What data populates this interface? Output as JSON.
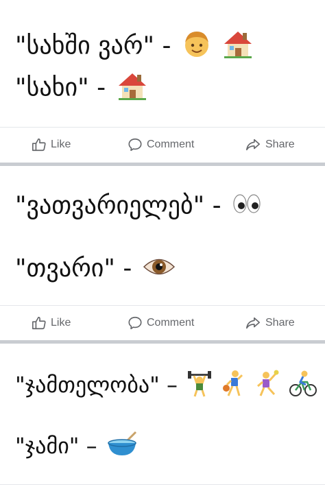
{
  "posts": [
    {
      "lines": [
        {
          "text": "\"სახში ვარ\" -",
          "emojis": [
            "person-face-icon",
            "house-icon"
          ]
        },
        {
          "text": "\"სახი\" -",
          "emojis": [
            "house-icon"
          ]
        }
      ]
    },
    {
      "lines": [
        {
          "text": "\"ვათვარიელებ\" -",
          "emojis": [
            "eyes-icon"
          ]
        },
        {
          "text": "\"თვარი\" -",
          "emojis": [
            "eye-icon"
          ]
        }
      ]
    },
    {
      "lines": [
        {
          "text": "\"ჯამთელობა\" –",
          "emojis": [
            "weightlifter-icon",
            "basketball-player-icon",
            "handball-player-icon",
            "cyclist-icon"
          ]
        },
        {
          "text": "\"ჯამი\" –",
          "emojis": [
            "bowl-icon"
          ]
        }
      ]
    }
  ],
  "actions": {
    "like": "Like",
    "comment": "Comment",
    "share": "Share"
  }
}
